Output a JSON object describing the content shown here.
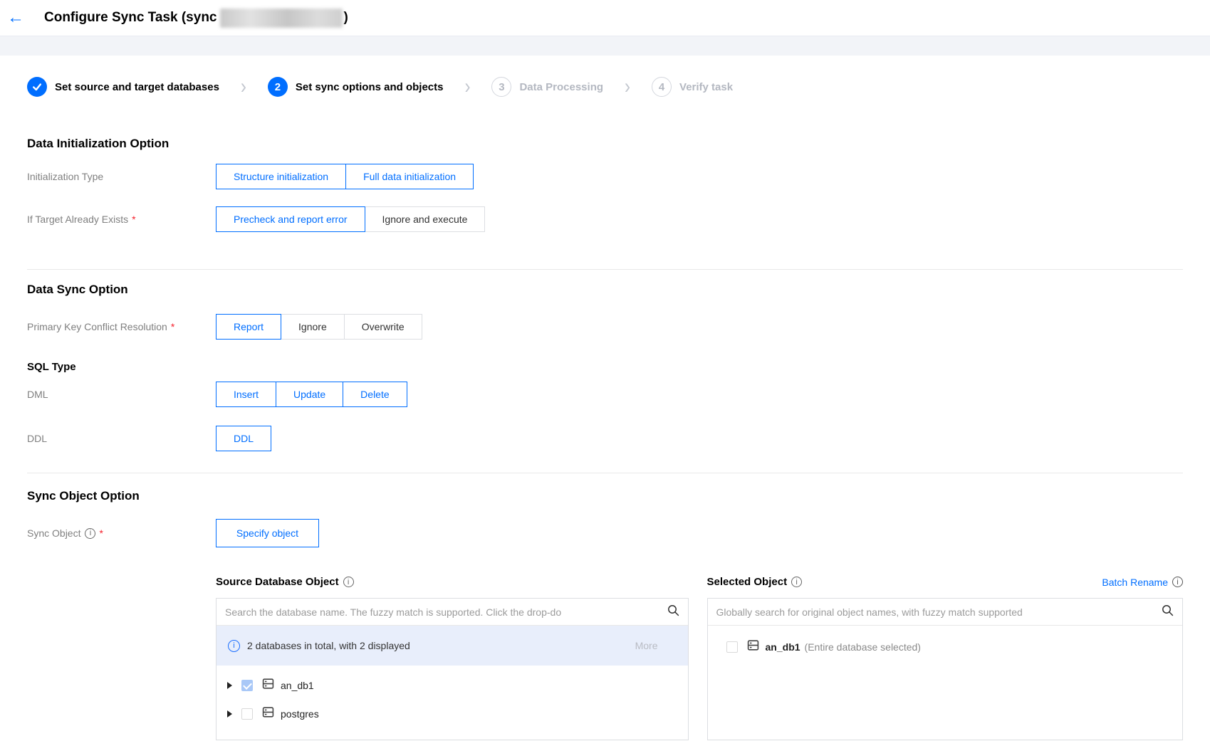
{
  "colors": {
    "accent": "#006eff",
    "info_bar_bg": "#e8eefb",
    "checked_light": "#a9c8f7"
  },
  "icons": {
    "back": "←",
    "step_separator": "›",
    "search": "magnifier-icon",
    "info": "circle-i-icon",
    "database": "database-icon",
    "caret": "collapsed-triangle"
  },
  "header": {
    "title_prefix": "Configure Sync Task (sync",
    "title_suffix": ")"
  },
  "steps": {
    "items": [
      {
        "num": "",
        "label": "Set source and target databases",
        "state": "done"
      },
      {
        "num": "2",
        "label": "Set sync options and objects",
        "state": "active"
      },
      {
        "num": "3",
        "label": "Data Processing",
        "state": "pending"
      },
      {
        "num": "4",
        "label": "Verify task",
        "state": "pending"
      }
    ]
  },
  "data_initialization": {
    "title": "Data Initialization Option",
    "initialization_type": {
      "label": "Initialization Type",
      "options": [
        {
          "label": "Structure initialization",
          "selected": true
        },
        {
          "label": "Full data initialization",
          "selected": true
        }
      ]
    },
    "if_target_exists": {
      "label": "If Target Already Exists",
      "required_mark": "*",
      "options": [
        {
          "label": "Precheck and report error",
          "selected": true
        },
        {
          "label": "Ignore and execute",
          "selected": false
        }
      ]
    }
  },
  "data_sync": {
    "title": "Data Sync Option",
    "pk_conflict": {
      "label": "Primary Key Conflict Resolution",
      "required_mark": "*",
      "options": [
        {
          "label": "Report",
          "selected": true
        },
        {
          "label": "Ignore",
          "selected": false
        },
        {
          "label": "Overwrite",
          "selected": false
        }
      ]
    },
    "sql_type_title": "SQL Type",
    "dml": {
      "label": "DML",
      "options": [
        {
          "label": "Insert",
          "selected": true
        },
        {
          "label": "Update",
          "selected": true
        },
        {
          "label": "Delete",
          "selected": true
        }
      ]
    },
    "ddl": {
      "label": "DDL",
      "options": [
        {
          "label": "DDL",
          "selected": true
        }
      ]
    }
  },
  "sync_object": {
    "title": "Sync Object Option",
    "label": "Sync Object",
    "required_mark": "*",
    "specify_button": "Specify object",
    "source_panel": {
      "title": "Source Database Object",
      "search_placeholder": "Search the database name. The fuzzy match is supported. Click the drop-do",
      "info_text": "2 databases in total, with 2 displayed",
      "more_link": "More",
      "tree": [
        {
          "name": "an_db1",
          "checked": true
        },
        {
          "name": "postgres",
          "checked": false
        }
      ]
    },
    "selected_panel": {
      "title": "Selected Object",
      "batch_rename_link": "Batch Rename",
      "search_placeholder": "Globally search for original object names, with fuzzy match supported",
      "items": [
        {
          "name": "an_db1",
          "note": "(Entire database selected)"
        }
      ]
    }
  }
}
